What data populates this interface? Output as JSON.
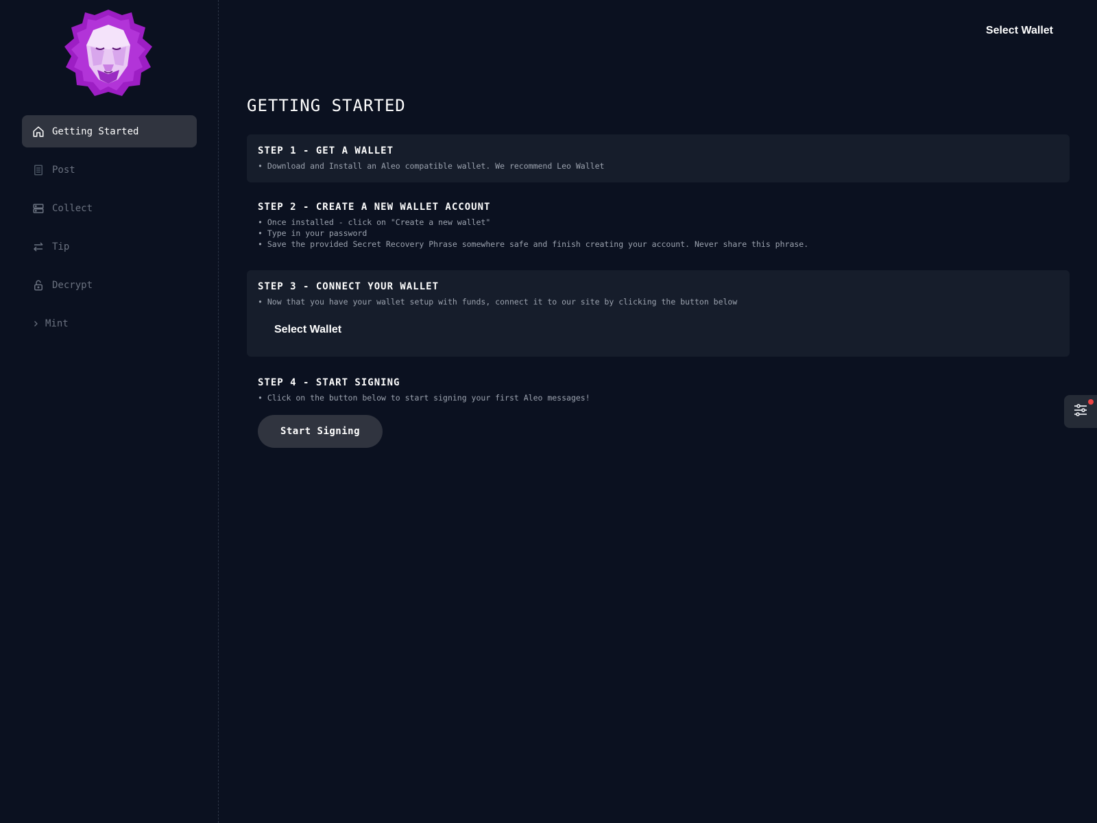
{
  "header": {
    "wallet_button": "Select Wallet"
  },
  "sidebar": {
    "logo": "lion-logo",
    "items": [
      {
        "label": "Getting Started",
        "icon": "home-icon",
        "active": true
      },
      {
        "label": "Post",
        "icon": "document-icon",
        "active": false
      },
      {
        "label": "Collect",
        "icon": "server-icon",
        "active": false
      },
      {
        "label": "Tip",
        "icon": "transfer-icon",
        "active": false
      },
      {
        "label": "Decrypt",
        "icon": "unlock-icon",
        "active": false
      },
      {
        "label": "Mint",
        "icon": "chevron-right-icon",
        "active": false
      }
    ]
  },
  "main": {
    "title": "GETTING STARTED",
    "steps": [
      {
        "heading": "STEP 1 - GET A WALLET",
        "lines": [
          "• Download and Install an Aleo compatible wallet. We recommend Leo Wallet"
        ]
      },
      {
        "heading": "STEP 2 - CREATE A NEW WALLET ACCOUNT",
        "lines": [
          "• Once installed - click on \"Create a new wallet\"",
          "• Type in your password",
          "• Save the provided Secret Recovery Phrase somewhere safe and finish creating your account. Never share this phrase."
        ]
      },
      {
        "heading": "STEP 3 - CONNECT YOUR WALLET",
        "lines": [
          "• Now that you have your wallet setup with funds, connect it to our site by clicking the button below"
        ],
        "button": "Select Wallet"
      },
      {
        "heading": "STEP 4 - START SIGNING",
        "lines": [
          "• Click on the button below to start signing your first Aleo messages!"
        ],
        "button": "Start Signing"
      }
    ]
  },
  "colors": {
    "background": "#0b1120",
    "card": "#161d2b",
    "active_nav": "#30343f",
    "accent_logo": "#a21caf",
    "notification": "#ef4444"
  },
  "fab": {
    "icon": "sliders-icon"
  }
}
